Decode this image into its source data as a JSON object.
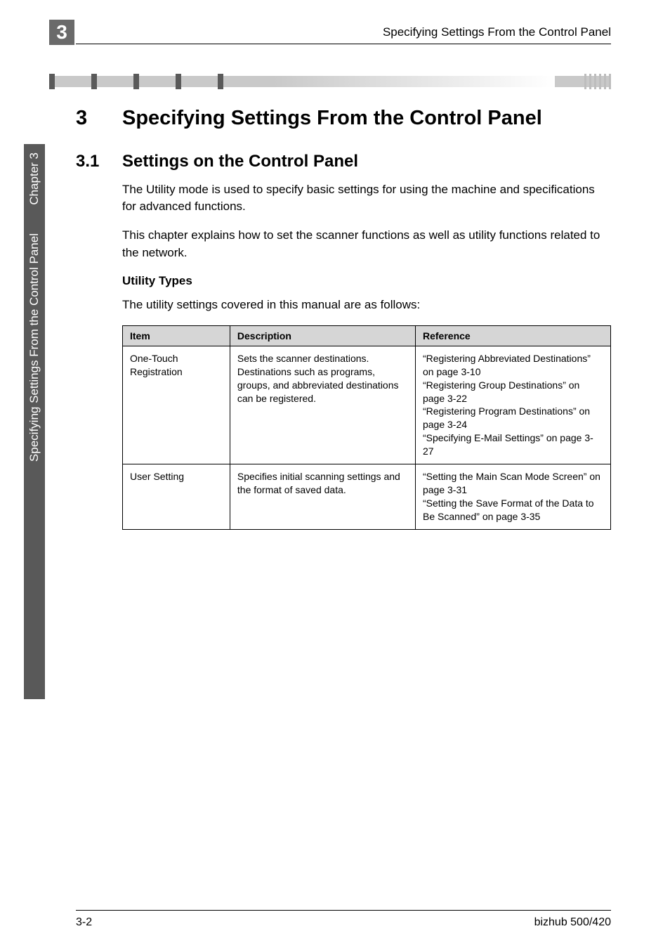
{
  "header": {
    "chapter_number_tab": "3",
    "running_head": "Specifying Settings From the Control Panel"
  },
  "side_tab": {
    "line1": "Chapter 3",
    "line2": "Specifying Settings From the Control Panel"
  },
  "section": {
    "number": "3",
    "title": "Specifying Settings From the Control Panel"
  },
  "subsection": {
    "number": "3.1",
    "title": "Settings on the Control Panel"
  },
  "paragraphs": {
    "p1": "The Utility mode is used to specify basic settings for using the machine and specifications for advanced functions.",
    "p2": "This chapter explains how to set the scanner functions as well as utility functions related to the network."
  },
  "utility_heading": "Utility Types",
  "utility_intro": "The utility settings covered in this manual are as follows:",
  "table": {
    "headers": {
      "item": "Item",
      "description": "Description",
      "reference": "Reference"
    },
    "rows": [
      {
        "item": "One-Touch Registration",
        "description": "Sets the scanner destinations. Destinations such as programs, groups, and abbreviated destinations can be registered.",
        "reference": "“Registering Abbreviated Destinations” on page 3-10\n“Registering Group Destinations” on page 3-22\n“Registering Program Destinations” on page 3-24\n“Specifying E-Mail Settings” on page 3-27"
      },
      {
        "item": "User Setting",
        "description": "Specifies initial scanning settings and the format of saved data.",
        "reference": "“Setting the Main Scan Mode Screen” on page 3-31\n“Setting the Save Format of the Data to Be Scanned” on page 3-35"
      }
    ]
  },
  "footer": {
    "left": "3-2",
    "right": "bizhub 500/420"
  }
}
